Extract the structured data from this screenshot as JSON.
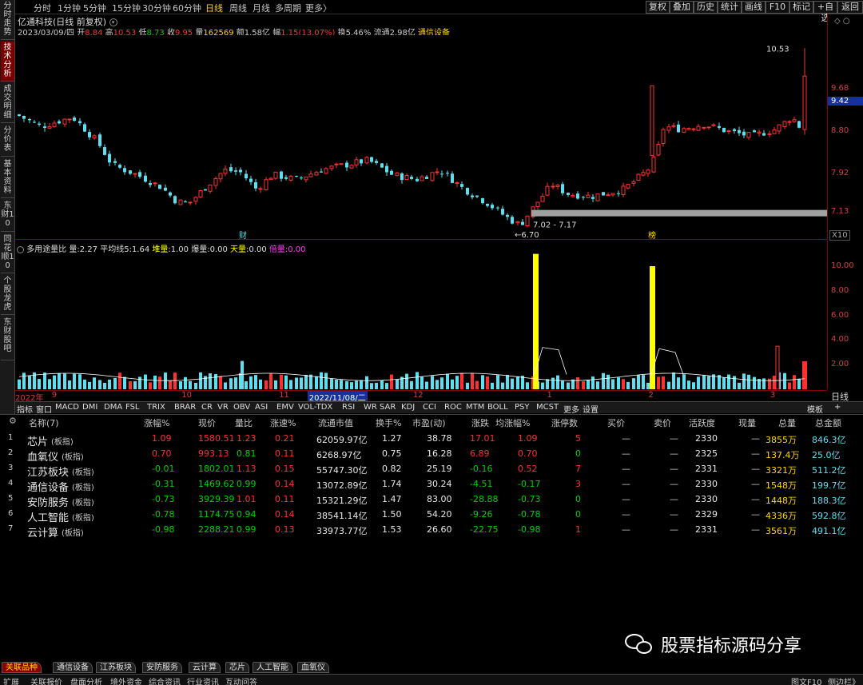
{
  "toolbar": {
    "periods": [
      "分时",
      "1分钟",
      "5分钟",
      "15分钟",
      "30分钟",
      "60分钟",
      "日线",
      "周线",
      "月线",
      "多周期",
      "更多〉"
    ],
    "active_period": "日线",
    "right_buttons": [
      "复权",
      "叠加",
      "历史",
      "统计",
      "画线",
      "F10",
      "标记",
      "+自选",
      "返回"
    ]
  },
  "left_tabs": [
    "分时走势",
    "技术分析",
    "成交明细",
    "分价表",
    "基本资料",
    "东财10",
    "同花顺10",
    "个股龙虎",
    "东财股吧"
  ],
  "chart_header": {
    "stock_title": "亿通科技(日线 前复权)",
    "date": "2023/03/09/四",
    "open_label": "开",
    "open": "8.84",
    "high_label": "高",
    "high": "10.53",
    "low_label": "低",
    "low": "8.73",
    "close_label": "收",
    "close": "9.95",
    "vol_label": "量",
    "vol": "162569",
    "amount_label": "额",
    "amount": "1.58亿",
    "change_label": "幅",
    "change": "1.15(13.07%)",
    "turnover_label": "换",
    "turnover": "5.46%",
    "float_label": "流通",
    "float": "2.98亿",
    "sector": "通信设备"
  },
  "kline_axis": {
    "labels": [
      "9.68",
      "8.80",
      "7.92",
      "7.13"
    ],
    "current": "9.42",
    "zoom": "X10"
  },
  "kline_annotations": {
    "high_mark": "10.53",
    "low_mark": "6.70",
    "range_label": "7.02 - 7.17",
    "event1": "财",
    "event2": "榜"
  },
  "volume_header": {
    "name": "多用途量比",
    "liang_label": "量:",
    "liang": "2.27",
    "ma_label": "平均线5:",
    "ma": "1.64",
    "dui_label": "堆量:",
    "dui": "1.00",
    "bao_label": "爆量:",
    "bao": "0.00",
    "tian_label": "天量:",
    "tian": "0.00",
    "bei_label": "倍量:",
    "bei": "0.00"
  },
  "volume_axis": {
    "labels": [
      "10.00",
      "8.00",
      "6.00",
      "4.00",
      "2.00"
    ]
  },
  "date_axis": [
    {
      "label": "2022年",
      "pos": 0.0
    },
    {
      "label": "9",
      "pos": 0.045
    },
    {
      "label": "10",
      "pos": 0.205
    },
    {
      "label": "11",
      "pos": 0.325
    },
    {
      "label": "2022/11/08/二",
      "pos": 0.36,
      "highlight": true
    },
    {
      "label": "12",
      "pos": 0.49
    },
    {
      "label": "1",
      "pos": 0.655
    },
    {
      "label": "2",
      "pos": 0.78
    },
    {
      "label": "3",
      "pos": 0.93
    }
  ],
  "date_axis_right": "日线",
  "indicator_tabs": [
    "指标",
    "窗口",
    "MACD",
    "DMI",
    "DMA",
    "FSL",
    "TRIX",
    "BRAR",
    "CR",
    "VR",
    "OBV",
    "ASI",
    "EMV",
    "VOL-TDX",
    "RSI",
    "WR",
    "SAR",
    "KDJ",
    "CCI",
    "ROC",
    "MTM",
    "BOLL",
    "PSY",
    "MCST",
    "更多",
    "设置"
  ],
  "indicator_right": [
    "模板",
    "+"
  ],
  "table": {
    "headers": [
      "名称(7)",
      "涨幅%",
      "现价",
      "量比",
      "涨速%",
      "流通市值",
      "换手%",
      "市盈(动)",
      "涨跌",
      "均涨幅%",
      "涨停数",
      "买价",
      "卖价",
      "活跃度",
      "现量",
      "总量",
      "总金额"
    ],
    "rows": [
      {
        "idx": "1",
        "name": "芯片",
        "tag": "(板指)",
        "chg": "1.09",
        "price": "1580.51",
        "lb": "1.23",
        "speed": "0.21",
        "mcap": "62059.97亿",
        "turn": "1.27",
        "pe": "38.78",
        "diff": "17.01",
        "avg": "1.09",
        "limit": "5",
        "buy": "—",
        "sell": "—",
        "active": "2330",
        "cur": "—",
        "vol": "3855万",
        "amt": "846.3亿",
        "dir": "up"
      },
      {
        "idx": "2",
        "name": "血氧仪",
        "tag": "(板指)",
        "chg": "0.70",
        "price": "993.13",
        "lb": "0.81",
        "speed": "0.11",
        "mcap": "6268.97亿",
        "turn": "0.75",
        "pe": "16.28",
        "diff": "6.89",
        "avg": "0.70",
        "limit": "0",
        "buy": "—",
        "sell": "—",
        "active": "2325",
        "cur": "—",
        "vol": "137.4万",
        "amt": "25.0亿",
        "dir": "up"
      },
      {
        "idx": "3",
        "name": "江苏板块",
        "tag": "(板指)",
        "chg": "-0.01",
        "price": "1802.01",
        "lb": "1.13",
        "speed": "0.15",
        "mcap": "55747.30亿",
        "turn": "0.82",
        "pe": "25.19",
        "diff": "-0.16",
        "avg": "0.52",
        "limit": "7",
        "buy": "—",
        "sell": "—",
        "active": "2331",
        "cur": "—",
        "vol": "3321万",
        "amt": "511.2亿",
        "dir": "down"
      },
      {
        "idx": "4",
        "name": "通信设备",
        "tag": "(板指)",
        "chg": "-0.31",
        "price": "1469.62",
        "lb": "0.99",
        "speed": "0.14",
        "mcap": "13072.89亿",
        "turn": "1.74",
        "pe": "30.24",
        "diff": "-4.51",
        "avg": "-0.17",
        "limit": "3",
        "buy": "—",
        "sell": "—",
        "active": "2330",
        "cur": "—",
        "vol": "1548万",
        "amt": "199.7亿",
        "dir": "down"
      },
      {
        "idx": "5",
        "name": "安防服务",
        "tag": "(板指)",
        "chg": "-0.73",
        "price": "3929.39",
        "lb": "1.01",
        "speed": "0.11",
        "mcap": "15321.29亿",
        "turn": "1.47",
        "pe": "83.00",
        "diff": "-28.88",
        "avg": "-0.73",
        "limit": "0",
        "buy": "—",
        "sell": "—",
        "active": "2330",
        "cur": "—",
        "vol": "1448万",
        "amt": "188.3亿",
        "dir": "down"
      },
      {
        "idx": "6",
        "name": "人工智能",
        "tag": "(板指)",
        "chg": "-0.78",
        "price": "1174.75",
        "lb": "0.94",
        "speed": "0.14",
        "mcap": "38541.14亿",
        "turn": "1.50",
        "pe": "54.20",
        "diff": "-9.26",
        "avg": "-0.78",
        "limit": "0",
        "buy": "—",
        "sell": "—",
        "active": "2329",
        "cur": "—",
        "vol": "4336万",
        "amt": "592.8亿",
        "dir": "down"
      },
      {
        "idx": "7",
        "name": "云计算",
        "tag": "(板指)",
        "chg": "-0.98",
        "price": "2288.21",
        "lb": "0.99",
        "speed": "0.13",
        "mcap": "33973.77亿",
        "turn": "1.53",
        "pe": "26.60",
        "diff": "-22.75",
        "avg": "-0.98",
        "limit": "1",
        "buy": "—",
        "sell": "—",
        "active": "2331",
        "cur": "—",
        "vol": "3561万",
        "amt": "491.1亿",
        "dir": "down"
      }
    ]
  },
  "bottom_tabs": [
    "关联品种",
    "通信设备",
    "江苏板块",
    "安防服务",
    "云计算",
    "芯片",
    "人工智能",
    "血氧仪"
  ],
  "status_tabs": [
    "扩展",
    "关联报价",
    "盘面分析",
    "境外资金",
    "综合资讯",
    "行业资讯",
    "互动问答"
  ],
  "status_right": [
    "图文F10",
    "侧边栏》"
  ],
  "watermark": "股票指标源码分享",
  "colors": {
    "up": "#ff3030",
    "down": "#00d000",
    "cyan": "#5ce0f0",
    "yellow": "#ffff00",
    "accent": "#ffd400"
  }
}
